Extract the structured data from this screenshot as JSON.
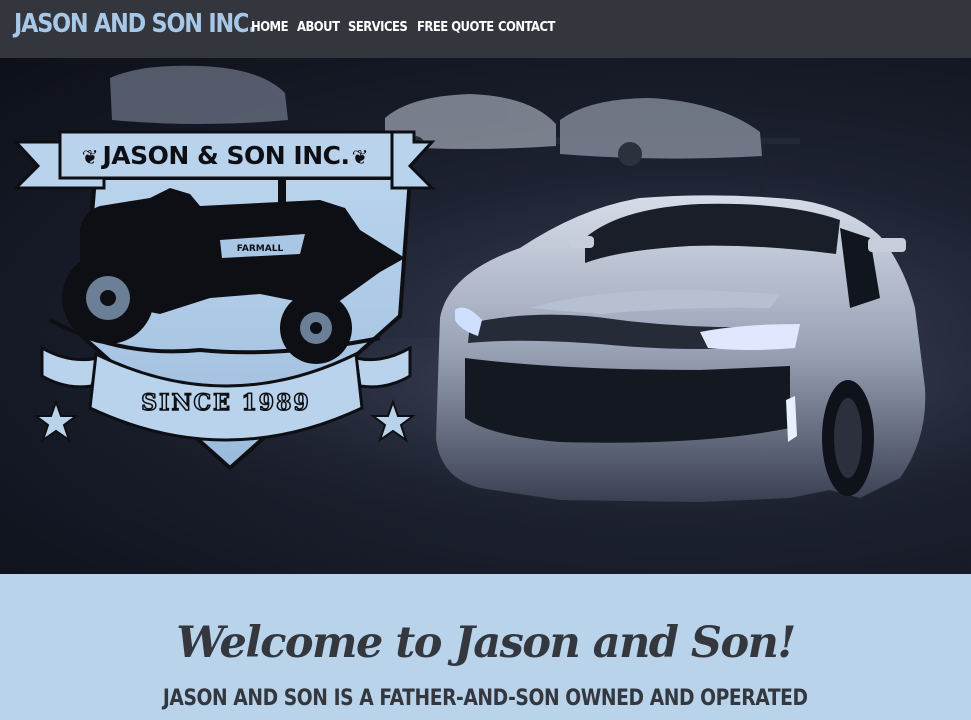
{
  "brand": {
    "name": "JASON AND SON INC."
  },
  "nav": {
    "items": [
      {
        "label": "HOME"
      },
      {
        "label": "ABOUT"
      },
      {
        "label": "SERVICES"
      },
      {
        "label": "FREE QUOTE"
      },
      {
        "label": "CONTACT"
      }
    ]
  },
  "hero": {
    "logo": {
      "banner_text": "JASON & SON INC.",
      "since_text": "SINCE 1989",
      "tractor_text": "FARMALL"
    }
  },
  "welcome": {
    "title": "Welcome to Jason and Son!",
    "subtitle": "JASON AND SON IS A FATHER-AND-SON OWNED AND OPERATED"
  },
  "colors": {
    "nav_bg": "#33363c",
    "brand": "#a8c8e8",
    "accent_light_blue": "#b8d3ea",
    "text_dark": "#34373e"
  }
}
